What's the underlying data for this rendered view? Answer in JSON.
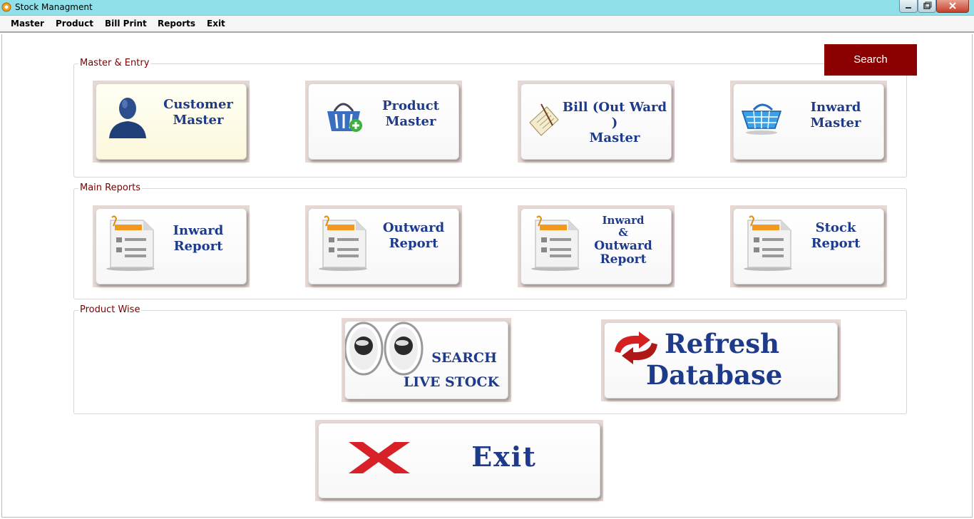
{
  "window": {
    "title": "Stock Managment"
  },
  "menu": {
    "items": [
      {
        "label": "Master"
      },
      {
        "label": "Product"
      },
      {
        "label": "Bill Print"
      },
      {
        "label": "Reports"
      },
      {
        "label": "Exit"
      }
    ]
  },
  "search": {
    "label": "Search"
  },
  "groups": {
    "master_entry": {
      "label": "Master & Entry",
      "tiles": [
        {
          "line1": "Customer",
          "line2": "Master"
        },
        {
          "line1": "Product",
          "line2": "Master"
        },
        {
          "line1": "Bill (Out Ward )",
          "line2": "Master"
        },
        {
          "line1": "Inward",
          "line2": "Master"
        }
      ]
    },
    "main_reports": {
      "label": "Main Reports",
      "tiles": [
        {
          "line1": "Inward",
          "line2": "Report"
        },
        {
          "line1": "Outward",
          "line2": "Report"
        },
        {
          "line1": "Inward",
          "line2": "&",
          "line3": "Outward",
          "line4": "Report"
        },
        {
          "line1": "Stock",
          "line2": "Report"
        }
      ]
    },
    "product_wise": {
      "label": "Product Wise",
      "live_stock": {
        "line1": "SEARCH",
        "line2": "LIVE STOCK"
      },
      "refresh": {
        "line1": "Refresh",
        "line2": "Database"
      }
    }
  },
  "exit_tile": {
    "label": "Exit"
  },
  "colors": {
    "titlebar": "#8fe0e8",
    "search_button": "#8b0000",
    "tile_text": "#1e3a8a",
    "group_label": "#7a0000",
    "tile_frame": "#e8d8d4"
  }
}
